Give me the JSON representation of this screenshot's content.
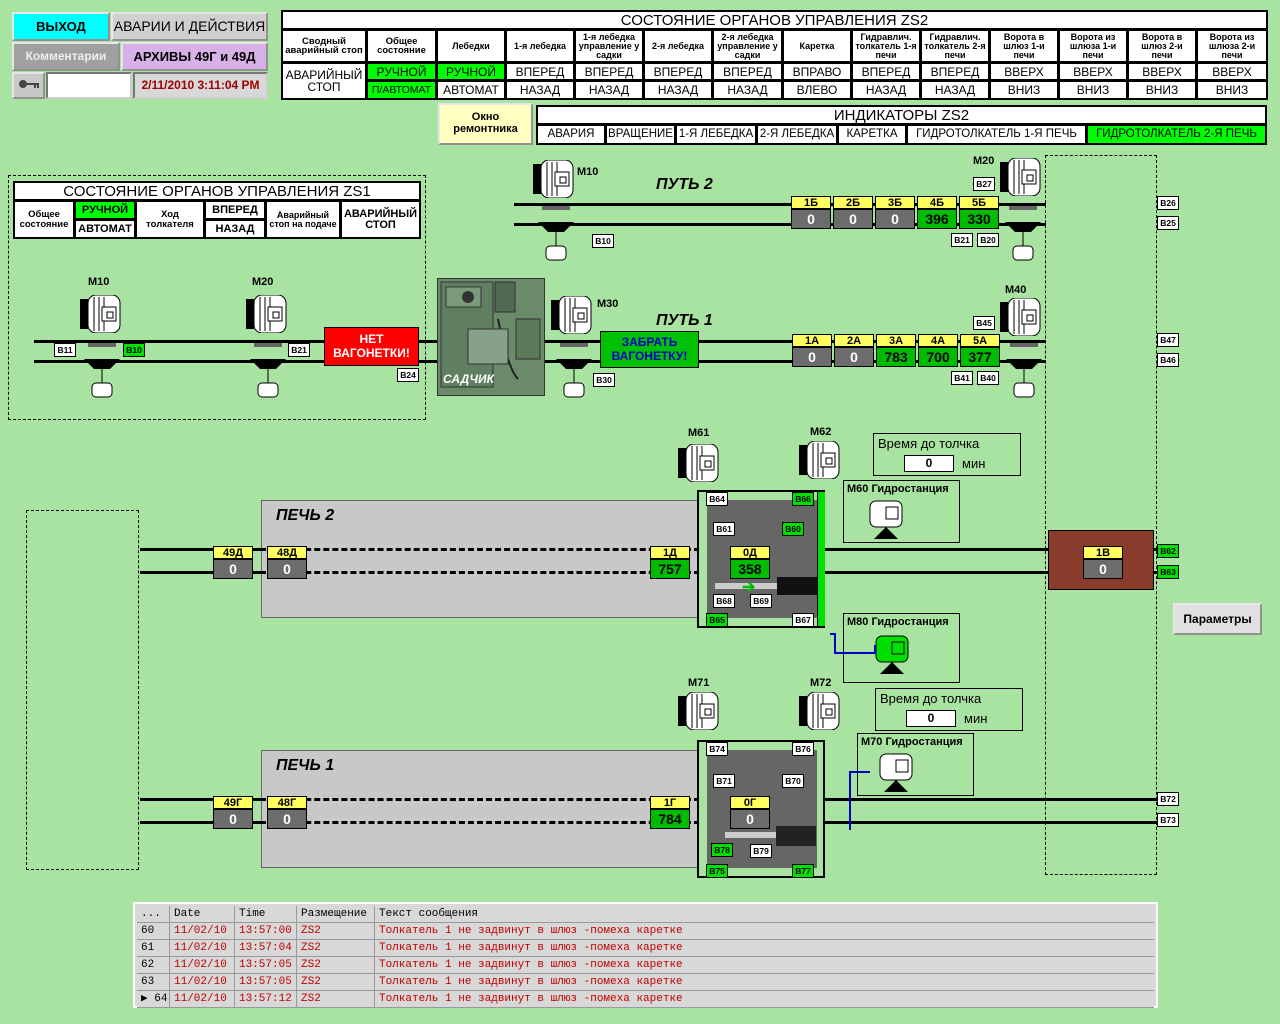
{
  "topleft": {
    "exit": "ВЫХОД",
    "alarms": "АВАРИИ И ДЕЙСТВИЯ",
    "comments": "Комментарии",
    "archives": "АРХИВЫ 49Г и 49Д",
    "datetime": "2/11/2010 3:11:04 PM",
    "colors": {
      "exit": "#00ffff",
      "archives": "#d8b0e8",
      "comments": "#a0a0a0"
    }
  },
  "zs2": {
    "title": "СОСТОЯНИЕ ОРГАНОВ УПРАВЛЕНИЯ ZS2",
    "headers": [
      "Сводный аварийный стоп",
      "Общее состояние",
      "Лебедки",
      "1-я лебедка",
      "1-я лебедка управление у садки",
      "2-я лебедка",
      "2-я лебедка управление у садки",
      "Каретка",
      "Гидравлич. толкатель 1-я печи",
      "Гидравлич. толкатель 2-я печи",
      "Ворота в шлюз 1-и печи",
      "Ворота из шлюза 1-и печи",
      "Ворота в шлюз 2-и печи",
      "Ворота из шлюза 2-и печи"
    ],
    "row1": [
      "АВАРИЙНЫЙ СТОП",
      "РУЧНОЙ",
      "РУЧНОЙ",
      "ВПЕРЕД",
      "ВПЕРЕД",
      "ВПЕРЕД",
      "ВПЕРЕД",
      "ВПРАВО",
      "ВПЕРЕД",
      "ВПЕРЕД",
      "ВВЕРХ",
      "ВВЕРХ",
      "ВВЕРХ",
      "ВВЕРХ"
    ],
    "row2": [
      "",
      "П/АВТОМАТ",
      "АВТОМАТ",
      "НАЗАД",
      "НАЗАД",
      "НАЗАД",
      "НАЗАД",
      "ВЛЕВО",
      "НАЗАД",
      "НАЗАД",
      "ВНИЗ",
      "ВНИЗ",
      "ВНИЗ",
      "ВНИЗ"
    ]
  },
  "repair": "Окно ремонтника",
  "ind": {
    "title": "ИНДИКАТОРЫ ZS2",
    "items": [
      "АВАРИЯ",
      "ВРАЩЕНИЕ",
      "1-Я ЛЕБЕДКА",
      "2-Я ЛЕБЕДКА",
      "КАРЕТКА",
      "ГИДРОТОЛКАТЕЛЬ 1-Я ПЕЧЬ",
      "ГИДРОТОЛКАТЕЛЬ 2-Я ПЕЧЬ"
    ]
  },
  "zs1": {
    "title": "СОСТОЯНИЕ ОРГАНОВ УПРАВЛЕНИЯ ZS1",
    "state": "Общее состояние",
    "manual": "РУЧНОЙ",
    "auto": "АВТОМАТ",
    "stroke": "Ход толкателя",
    "fwd": "ВПЕРЕД",
    "back": "НАЗАД",
    "estop_feed": "Аварийный стоп на подаче",
    "estop": "АВАРИЙНЫЙ СТОП"
  },
  "path2": "ПУТЬ 2",
  "path1": "ПУТЬ 1",
  "no_cart": "НЕТ ВАГОНЕТКИ!",
  "take_cart": "ЗАБРАТЬ ВАГОНЕТКУ!",
  "sadchik": "САДЧИК",
  "motors": {
    "m10": "M10",
    "m20": "M20",
    "m30": "M30",
    "m40": "M40",
    "m61": "M61",
    "m62": "M62",
    "m71": "M71",
    "m72": "M72"
  },
  "gauges_p2": [
    {
      "l": "1Б",
      "v": "0"
    },
    {
      "l": "2Б",
      "v": "0"
    },
    {
      "l": "3Б",
      "v": "0"
    },
    {
      "l": "4Б",
      "v": "396"
    },
    {
      "l": "5Б",
      "v": "330"
    }
  ],
  "gauges_p1": [
    {
      "l": "1А",
      "v": "0"
    },
    {
      "l": "2А",
      "v": "0"
    },
    {
      "l": "3А",
      "v": "783"
    },
    {
      "l": "4А",
      "v": "700"
    },
    {
      "l": "5А",
      "v": "377"
    }
  ],
  "oven2": {
    "title": "ПЕЧЬ 2",
    "g49": {
      "l": "49Д",
      "v": "0"
    },
    "g48": {
      "l": "48Д",
      "v": "0"
    },
    "g1": {
      "l": "1Д",
      "v": "757"
    },
    "g0": {
      "l": "0Д",
      "v": "358"
    }
  },
  "oven1": {
    "title": "ПЕЧЬ 1",
    "g49": {
      "l": "49Г",
      "v": "0"
    },
    "g48": {
      "l": "48Г",
      "v": "0"
    },
    "g1": {
      "l": "1Г",
      "v": "784"
    },
    "g0": {
      "l": "0Г",
      "v": "0"
    }
  },
  "g1v": {
    "l": "1В",
    "v": "0"
  },
  "timer2": {
    "label": "Время до толчка",
    "value": "0",
    "unit": "мин"
  },
  "timer1": {
    "label": "Время до толчка",
    "value": "0",
    "unit": "мин"
  },
  "hs60": "М60 Гидростанция",
  "hs80": "М80 Гидростанция",
  "hs70": "М70 Гидростанция",
  "params": "Параметры",
  "sensors": {
    "B10": "B10",
    "B11": "B11",
    "B21": "B21",
    "B24": "B24",
    "B30": "B30",
    "B20": "B20",
    "B27": "B27",
    "B26": "B26",
    "B25": "B25",
    "B47": "B47",
    "B46": "B46",
    "B45": "B45",
    "B41": "B41",
    "B40": "B40",
    "B64": "B64",
    "B66": "B66",
    "B61": "B61",
    "B60": "B60",
    "B68": "B68",
    "B69": "B69",
    "B65": "B65",
    "B67": "B67",
    "B62": "B62",
    "B63": "B63",
    "B74": "B74",
    "B76": "B76",
    "B71": "B71",
    "B70": "B70",
    "B78": "B78",
    "B79": "B79",
    "B75": "B75",
    "B77": "B77",
    "B72": "B72",
    "B73": "B73"
  },
  "log": {
    "headers": [
      "...",
      "Date",
      "Time",
      "Размещение",
      "Текст сообщения"
    ],
    "rows": [
      [
        "60",
        "11/02/10",
        "13:57:00",
        "ZS2",
        "Толкатель 1 не задвинут в шлюз -помеха каретке"
      ],
      [
        "61",
        "11/02/10",
        "13:57:04",
        "ZS2",
        "Толкатель 1 не задвинут в шлюз -помеха каретке"
      ],
      [
        "62",
        "11/02/10",
        "13:57:05",
        "ZS2",
        "Толкатель 1 не задвинут в шлюз -помеха каретке"
      ],
      [
        "63",
        "11/02/10",
        "13:57:05",
        "ZS2",
        "Толкатель 1 не задвинут в шлюз -помеха каретке"
      ],
      [
        "64",
        "11/02/10",
        "13:57:12",
        "ZS2",
        "Толкатель 1 не задвинут в шлюз -помеха каретке"
      ]
    ]
  }
}
